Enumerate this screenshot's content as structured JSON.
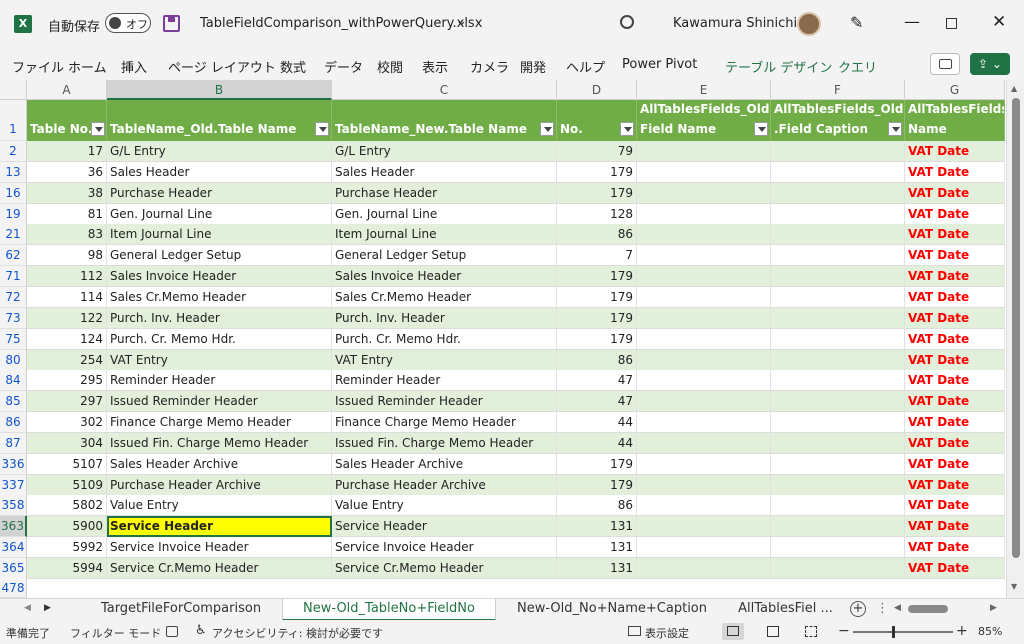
{
  "titlebar": {
    "autosave_label": "自動保存",
    "autosave_state": "オフ",
    "filename": "TableFieldComparison_withPowerQuery.xlsx",
    "user": "Kawamura Shinichi"
  },
  "menu": [
    "ファイル",
    "ホーム",
    "挿入",
    "ページ レイアウト",
    "数式",
    "データ",
    "校閲",
    "表示",
    "カメラ",
    "開発",
    "ヘルプ",
    "Power Pivot",
    "テーブル デザイン",
    "クエリ"
  ],
  "columns": [
    "A",
    "B",
    "C",
    "D",
    "E",
    "F",
    "G"
  ],
  "headers": {
    "a": "Table No.",
    "b": "TableName_Old.Table Name",
    "c": "TableName_New.Table Name",
    "d": "No.",
    "e1": "AllTablesFields_Old.",
    "e2": "Field Name",
    "f1": "AllTablesFields_Old",
    "f2": ".Field Caption",
    "g1": "AllTablesFields",
    "g2": "Name"
  },
  "header_row_num": "1",
  "rows": [
    {
      "r": "2",
      "a": "17",
      "b": "G/L Entry",
      "c": "G/L Entry",
      "d": "79",
      "g": "VAT Date"
    },
    {
      "r": "13",
      "a": "36",
      "b": "Sales Header",
      "c": "Sales Header",
      "d": "179",
      "g": "VAT Date"
    },
    {
      "r": "16",
      "a": "38",
      "b": "Purchase Header",
      "c": "Purchase Header",
      "d": "179",
      "g": "VAT Date"
    },
    {
      "r": "19",
      "a": "81",
      "b": "Gen. Journal Line",
      "c": "Gen. Journal Line",
      "d": "128",
      "g": "VAT Date"
    },
    {
      "r": "21",
      "a": "83",
      "b": "Item Journal Line",
      "c": "Item Journal Line",
      "d": "86",
      "g": "VAT Date"
    },
    {
      "r": "62",
      "a": "98",
      "b": "General Ledger Setup",
      "c": "General Ledger Setup",
      "d": "7",
      "g": "VAT Date"
    },
    {
      "r": "71",
      "a": "112",
      "b": "Sales Invoice Header",
      "c": "Sales Invoice Header",
      "d": "179",
      "g": "VAT Date"
    },
    {
      "r": "72",
      "a": "114",
      "b": "Sales Cr.Memo Header",
      "c": "Sales Cr.Memo Header",
      "d": "179",
      "g": "VAT Date"
    },
    {
      "r": "73",
      "a": "122",
      "b": "Purch. Inv. Header",
      "c": "Purch. Inv. Header",
      "d": "179",
      "g": "VAT Date"
    },
    {
      "r": "75",
      "a": "124",
      "b": "Purch. Cr. Memo Hdr.",
      "c": "Purch. Cr. Memo Hdr.",
      "d": "179",
      "g": "VAT Date"
    },
    {
      "r": "80",
      "a": "254",
      "b": "VAT Entry",
      "c": "VAT Entry",
      "d": "86",
      "g": "VAT Date"
    },
    {
      "r": "84",
      "a": "295",
      "b": "Reminder Header",
      "c": "Reminder Header",
      "d": "47",
      "g": "VAT Date"
    },
    {
      "r": "85",
      "a": "297",
      "b": "Issued Reminder Header",
      "c": "Issued Reminder Header",
      "d": "47",
      "g": "VAT Date"
    },
    {
      "r": "86",
      "a": "302",
      "b": "Finance Charge Memo Header",
      "c": "Finance Charge Memo Header",
      "d": "44",
      "g": "VAT Date"
    },
    {
      "r": "87",
      "a": "304",
      "b": "Issued Fin. Charge Memo Header",
      "c": "Issued Fin. Charge Memo Header",
      "d": "44",
      "g": "VAT Date"
    },
    {
      "r": "336",
      "a": "5107",
      "b": "Sales Header Archive",
      "c": "Sales Header Archive",
      "d": "179",
      "g": "VAT Date"
    },
    {
      "r": "337",
      "a": "5109",
      "b": "Purchase Header Archive",
      "c": "Purchase Header Archive",
      "d": "179",
      "g": "VAT Date"
    },
    {
      "r": "358",
      "a": "5802",
      "b": "Value Entry",
      "c": "Value Entry",
      "d": "86",
      "g": "VAT Date"
    },
    {
      "r": "363",
      "a": "5900",
      "b": "Service Header",
      "c": "Service Header",
      "d": "131",
      "g": "VAT Date"
    },
    {
      "r": "364",
      "a": "5992",
      "b": "Service Invoice Header",
      "c": "Service Invoice Header",
      "d": "131",
      "g": "VAT Date"
    },
    {
      "r": "365",
      "a": "5994",
      "b": "Service Cr.Memo Header",
      "c": "Service Cr.Memo Header",
      "d": "131",
      "g": "VAT Date"
    }
  ],
  "last_row_num": "478",
  "sheet_tabs": [
    "TargetFileForComparison",
    "New-Old_TableNo+FieldNo",
    "New-Old_No+Name+Caption",
    "AllTablesFiel ..."
  ],
  "active_tab_index": 1,
  "status": {
    "ready": "準備完了",
    "filter_mode": "フィルター モード",
    "accessibility": "アクセシビリティ: 検討が必要です",
    "display_settings": "表示設定",
    "zoom": "85%"
  },
  "colors": {
    "header_green": "#70ad47",
    "band_green": "#e2efda",
    "excel_green": "#217346",
    "vat_red": "#ff0000",
    "highlight_yellow": "#ffff00"
  }
}
